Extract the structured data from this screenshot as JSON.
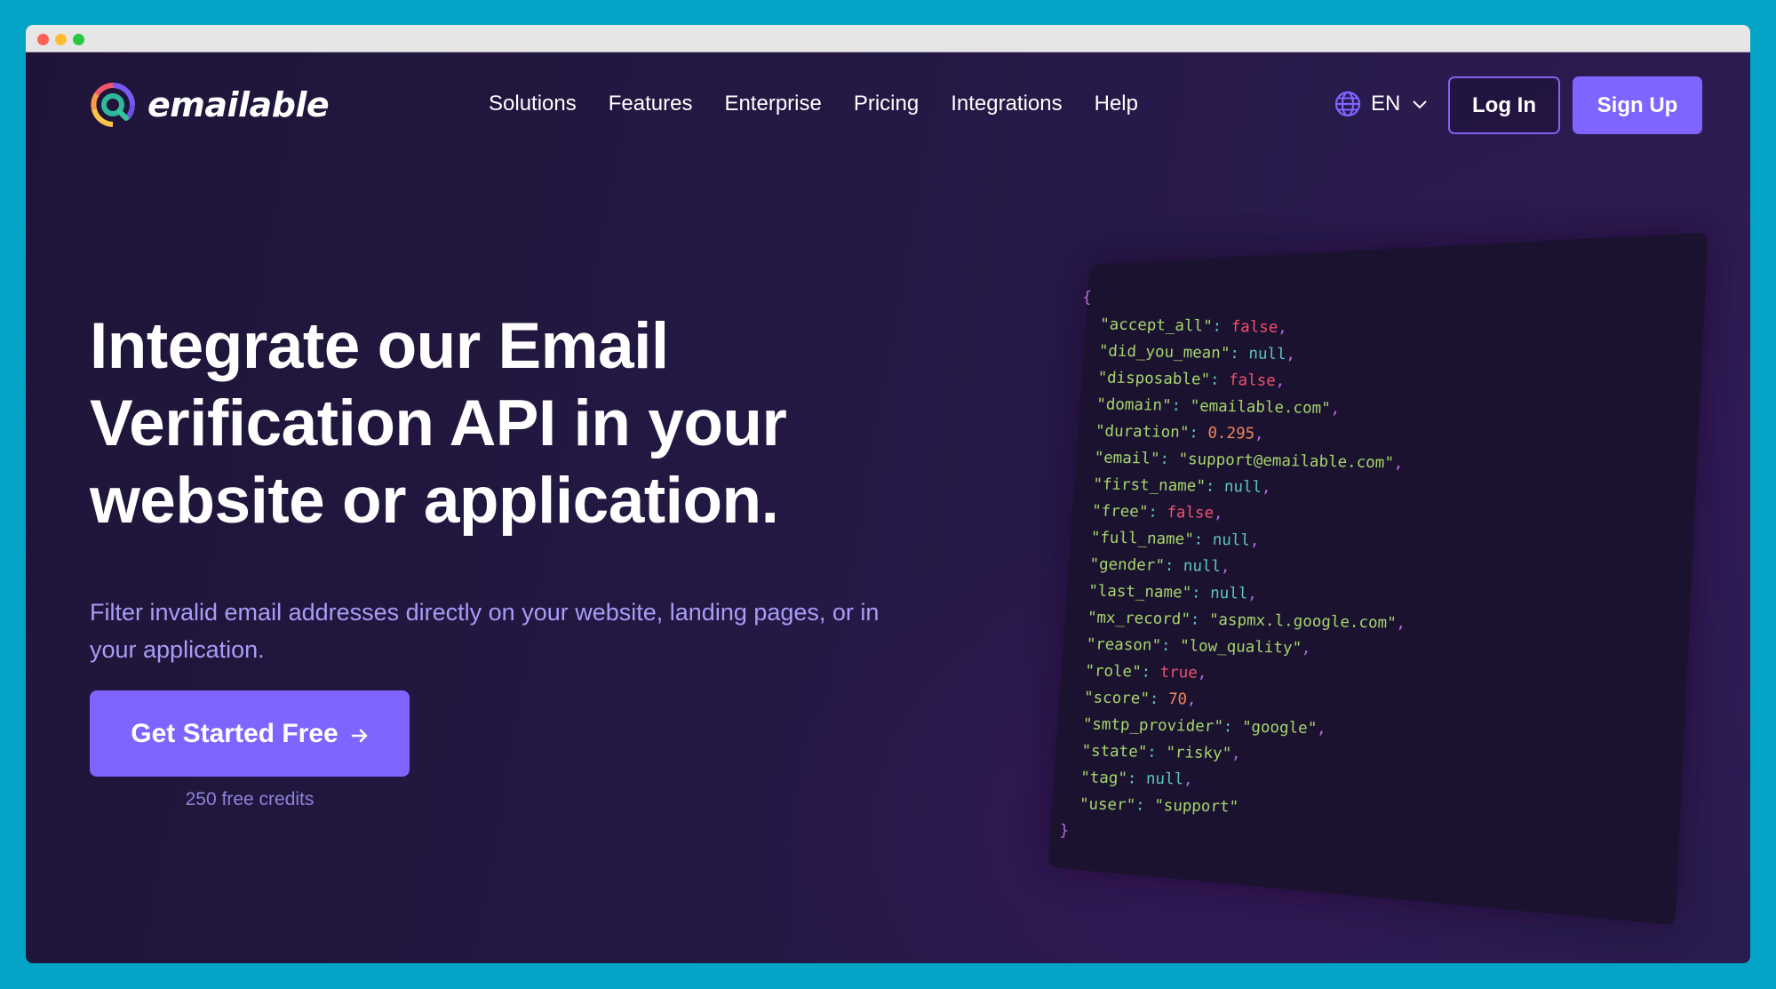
{
  "window": {
    "controls": [
      "close",
      "minimize",
      "maximize"
    ]
  },
  "brand": {
    "name": "emailable",
    "logo_icon": "at-sign-ring-icon"
  },
  "nav": {
    "items": [
      {
        "label": "Solutions"
      },
      {
        "label": "Features"
      },
      {
        "label": "Enterprise"
      },
      {
        "label": "Pricing"
      },
      {
        "label": "Integrations"
      },
      {
        "label": "Help"
      }
    ],
    "language": {
      "icon": "globe-icon",
      "label": "EN",
      "dropdown_icon": "chevron-down-icon"
    },
    "login_label": "Log In",
    "signup_label": "Sign Up"
  },
  "hero": {
    "title_lines": [
      "Integrate our Email",
      "Verification API in your",
      "website or application."
    ],
    "subtitle_lines": [
      "Filter invalid email addresses directly on your website, landing pages, or in",
      "your application."
    ],
    "cta_label": "Get Started Free",
    "cta_icon": "arrow-right-icon",
    "cta_note": "250 free credits"
  },
  "code_sample": {
    "open": "{",
    "close": "}",
    "entries": [
      {
        "key": "accept_all",
        "value": "false",
        "type": "bool"
      },
      {
        "key": "did_you_mean",
        "value": "null",
        "type": "null"
      },
      {
        "key": "disposable",
        "value": "false",
        "type": "bool"
      },
      {
        "key": "domain",
        "value": "\"emailable.com\"",
        "type": "string"
      },
      {
        "key": "duration",
        "value": "0.295",
        "type": "number"
      },
      {
        "key": "email",
        "value": "\"support@emailable.com\"",
        "type": "string"
      },
      {
        "key": "first_name",
        "value": "null",
        "type": "null"
      },
      {
        "key": "free",
        "value": "false",
        "type": "bool"
      },
      {
        "key": "full_name",
        "value": "null",
        "type": "null"
      },
      {
        "key": "gender",
        "value": "null",
        "type": "null"
      },
      {
        "key": "last_name",
        "value": "null",
        "type": "null"
      },
      {
        "key": "mx_record",
        "value": "\"aspmx.l.google.com\"",
        "type": "string"
      },
      {
        "key": "reason",
        "value": "\"low_quality\"",
        "type": "string"
      },
      {
        "key": "role",
        "value": "true",
        "type": "bool"
      },
      {
        "key": "score",
        "value": "70",
        "type": "number"
      },
      {
        "key": "smtp_provider",
        "value": "\"google\"",
        "type": "string"
      },
      {
        "key": "state",
        "value": "\"risky\"",
        "type": "string"
      },
      {
        "key": "tag",
        "value": "null",
        "type": "null"
      },
      {
        "key": "user",
        "value": "\"support\"",
        "type": "string"
      }
    ]
  },
  "colors": {
    "outer_background": "#04A4C6",
    "page_background": "#21163A",
    "accent": "#8064FF",
    "subtitle": "#A99CF6",
    "code_panel": "#1B1230",
    "json_key": "#A6D66B",
    "json_bool": "#F0506E",
    "json_null": "#5EC5C0",
    "json_number": "#F0855A",
    "json_punct": "#B76BE0"
  }
}
